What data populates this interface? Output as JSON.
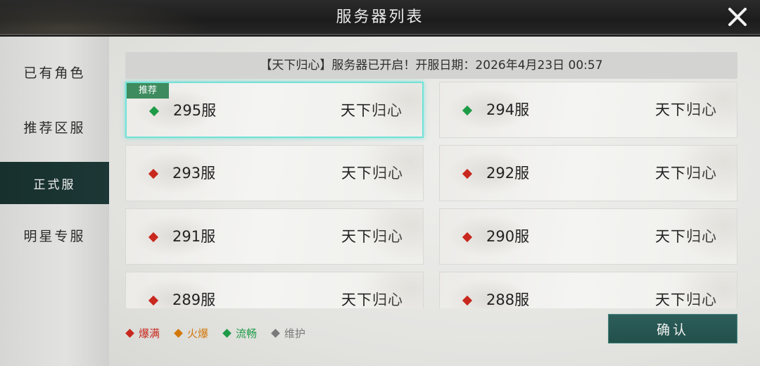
{
  "title": "服务器列表",
  "sidebar": {
    "items": [
      {
        "label": "已有角色",
        "active": false
      },
      {
        "label": "推荐区服",
        "active": false
      },
      {
        "label": "正式服",
        "active": true
      },
      {
        "label": "明星专服",
        "active": false
      }
    ]
  },
  "announcement": "【天下归心】服务器已开启！开服日期：2026年4月23日 00:57",
  "servers": [
    {
      "name": "295服",
      "region": "天下归心",
      "status": "流畅",
      "recommended": true,
      "selected": true,
      "tag": "推荐"
    },
    {
      "name": "294服",
      "region": "天下归心",
      "status": "流畅"
    },
    {
      "name": "293服",
      "region": "天下归心",
      "status": "爆满"
    },
    {
      "name": "292服",
      "region": "天下归心",
      "status": "爆满"
    },
    {
      "name": "291服",
      "region": "天下归心",
      "status": "爆满"
    },
    {
      "name": "290服",
      "region": "天下归心",
      "status": "爆满"
    },
    {
      "name": "289服",
      "region": "天下归心",
      "status": "爆满"
    },
    {
      "name": "288服",
      "region": "天下归心",
      "status": "爆满"
    }
  ],
  "legend": [
    {
      "label": "爆满",
      "color": "#c8281e"
    },
    {
      "label": "火爆",
      "color": "#d2780a"
    },
    {
      "label": "流畅",
      "color": "#1e9b46"
    },
    {
      "label": "维护",
      "color": "#7a7a7a"
    }
  ],
  "status_colors": {
    "爆满": "#c8281e",
    "火爆": "#d2780a",
    "流畅": "#1e9b46",
    "维护": "#7a7a7a"
  },
  "confirm_label": "确认",
  "icons": {
    "close": "close-x-icon",
    "status": "diamond-icon"
  }
}
